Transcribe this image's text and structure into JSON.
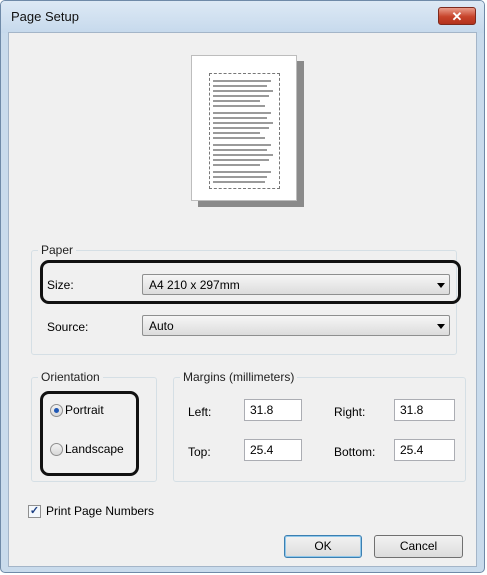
{
  "window": {
    "title": "Page Setup",
    "close_glyph": "✕"
  },
  "paper": {
    "legend": "Paper",
    "size_label": "Size:",
    "size_value": "A4 210 x 297mm",
    "source_label": "Source:",
    "source_value": "Auto"
  },
  "orientation": {
    "legend": "Orientation",
    "portrait_label": "Portrait",
    "landscape_label": "Landscape",
    "selected": "Portrait"
  },
  "margins": {
    "legend": "Margins (millimeters)",
    "left_label": "Left:",
    "left_value": "31.8",
    "right_label": "Right:",
    "right_value": "31.8",
    "top_label": "Top:",
    "top_value": "25.4",
    "bottom_label": "Bottom:",
    "bottom_value": "25.4"
  },
  "print_page_numbers": {
    "label": "Print Page Numbers",
    "checked": true
  },
  "buttons": {
    "ok": "OK",
    "cancel": "Cancel"
  },
  "colors": {
    "title_bar": "#c6d9ec",
    "close_button": "#c7432a",
    "highlight": "#111111"
  }
}
